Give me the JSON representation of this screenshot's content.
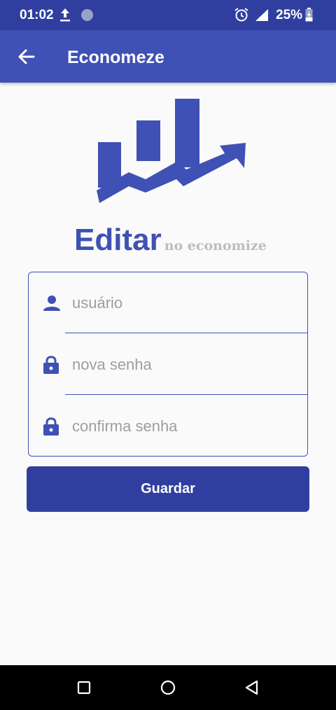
{
  "status_bar": {
    "time": "01:02",
    "battery": "25%",
    "icons": [
      "upload-icon",
      "sync-icon",
      "alarm-icon",
      "signal-icon",
      "battery-icon"
    ]
  },
  "app_bar": {
    "title": "Economeze",
    "back_icon": "arrow-back-icon"
  },
  "heading": {
    "main": "Editar",
    "sub": "no economize"
  },
  "form": {
    "username_placeholder": "usuário",
    "new_password_placeholder": "nova senha",
    "confirm_password_placeholder": "confirma senha"
  },
  "actions": {
    "save_label": "Guardar"
  },
  "nav_bar": {
    "icons": [
      "recents-square-icon",
      "home-circle-icon",
      "back-triangle-icon"
    ]
  },
  "colors": {
    "primary": "#3f51b5",
    "primary_dark": "#303f9f",
    "background": "#fafafa",
    "hint": "#9e9e9e",
    "subtitle": "#bdbdbd"
  }
}
